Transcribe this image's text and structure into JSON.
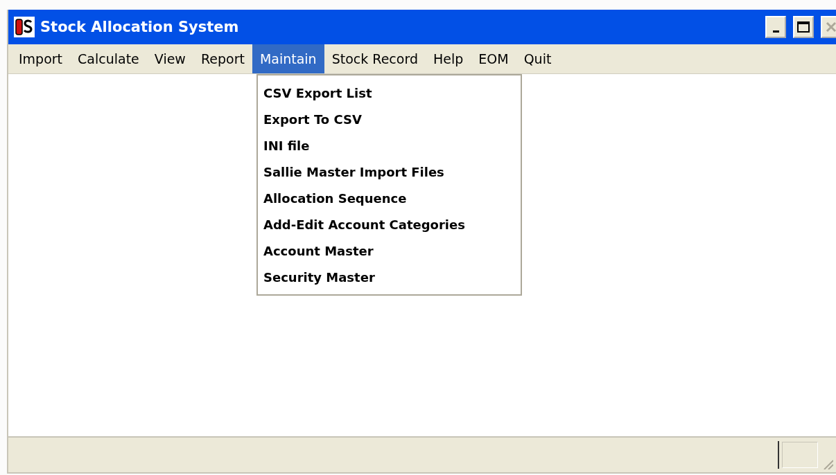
{
  "window": {
    "title": "Stock Allocation System",
    "controls": [
      {
        "kind": "minimize",
        "disabled": false
      },
      {
        "kind": "maximize",
        "disabled": false
      },
      {
        "kind": "close",
        "disabled": true
      }
    ]
  },
  "menu_bar": [
    {
      "label": "Import",
      "selected": false
    },
    {
      "label": "Calculate",
      "selected": false
    },
    {
      "label": "View",
      "selected": false
    },
    {
      "label": "Report",
      "selected": false
    },
    {
      "label": "Maintain",
      "selected": true
    },
    {
      "label": "Stock Record",
      "selected": false
    },
    {
      "label": "Help",
      "selected": false
    },
    {
      "label": "EOM",
      "selected": false
    },
    {
      "label": "Quit",
      "selected": false
    }
  ],
  "dropdown": {
    "items": [
      "CSV Export List",
      "Export To CSV",
      "INI file",
      "Sallie Master Import Files",
      "Allocation Sequence",
      "Add-Edit Account Categories",
      "Account Master",
      "Security Master"
    ]
  }
}
